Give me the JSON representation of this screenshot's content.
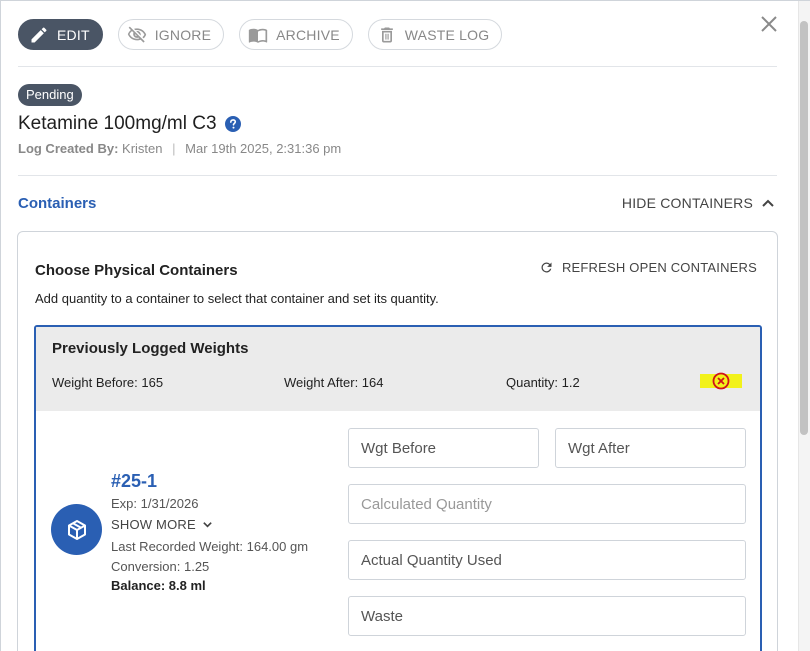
{
  "toolbar": {
    "edit": "EDIT",
    "ignore": "IGNORE",
    "archive": "ARCHIVE",
    "waste_log": "WASTE LOG"
  },
  "status": "Pending",
  "title": "Ketamine 100mg/ml C3",
  "log": {
    "created_by_label": "Log Created By:",
    "created_by": "Kristen",
    "timestamp": "Mar 19th 2025, 2:31:36 pm"
  },
  "containers": {
    "section_title": "Containers",
    "hide_label": "HIDE CONTAINERS",
    "card_title": "Choose Physical Containers",
    "card_subtitle": "Add quantity to a container to select that container and set its quantity.",
    "refresh_label": "REFRESH OPEN CONTAINERS"
  },
  "previous": {
    "title": "Previously Logged Weights",
    "weight_before": "Weight Before: 165",
    "weight_after": "Weight After: 164",
    "quantity": "Quantity: 1.2"
  },
  "container": {
    "id": "#25-1",
    "exp": "Exp: 1/31/2026",
    "show_more": "SHOW MORE",
    "last_weight": "Last Recorded Weight: 164.00 gm",
    "conversion": "Conversion: 1.25",
    "balance": "Balance: 8.8 ml"
  },
  "fields": {
    "wgt_before": "Wgt Before",
    "wgt_after": "Wgt After",
    "calculated": "Calculated Quantity",
    "actual": "Actual Quantity Used",
    "waste": "Waste"
  },
  "colors": {
    "accent": "#2a5fb3",
    "badge": "#4a5565",
    "highlight": "#f2f21a",
    "remove": "#d0121b"
  }
}
